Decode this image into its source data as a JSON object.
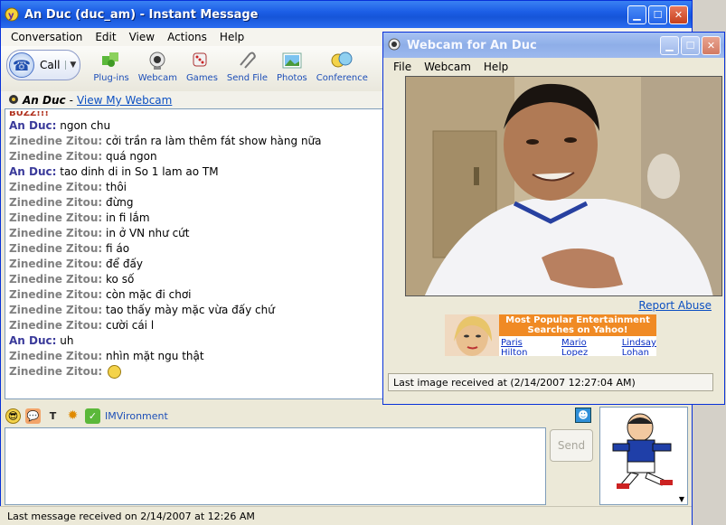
{
  "main_window": {
    "title": "An Duc (duc_am) - Instant Message",
    "menu": [
      "Conversation",
      "Edit",
      "View",
      "Actions",
      "Help"
    ],
    "toolbar": {
      "call": "Call",
      "tools": [
        "Plug-ins",
        "Webcam",
        "Games",
        "Send File",
        "Photos",
        "Conference"
      ]
    },
    "userbar": {
      "name": "An Duc",
      "separator": "-",
      "link": "View My Webcam"
    },
    "chat": {
      "buzz": "BUZZ!!!",
      "messages": [
        {
          "sender": "An Duc:",
          "text": "ngon chu"
        },
        {
          "sender": "Zinedine Zitou:",
          "text": "cởi trần ra làm thêm fát show hàng nữa"
        },
        {
          "sender": "Zinedine Zitou:",
          "text": "quá ngon"
        },
        {
          "sender": "An Duc:",
          "text": "tao dinh di in So 1 lam ao TM"
        },
        {
          "sender": "Zinedine Zitou:",
          "text": "thôi"
        },
        {
          "sender": "Zinedine Zitou:",
          "text": "đừng"
        },
        {
          "sender": "Zinedine Zitou:",
          "text": "in fi lắm"
        },
        {
          "sender": "Zinedine Zitou:",
          "text": "in ở VN như cứt"
        },
        {
          "sender": "Zinedine Zitou:",
          "text": "fi áo"
        },
        {
          "sender": "Zinedine Zitou:",
          "text": "để đấy"
        },
        {
          "sender": "Zinedine Zitou:",
          "text": "ko số"
        },
        {
          "sender": "Zinedine Zitou:",
          "text": "còn mặc đi chơi"
        },
        {
          "sender": "Zinedine Zitou:",
          "text": "tao thấy mày mặc vừa đấy chứ"
        },
        {
          "sender": "Zinedine Zitou:",
          "text": "cười cái l"
        },
        {
          "sender": "An Duc:",
          "text": "uh"
        },
        {
          "sender": "Zinedine Zitou:",
          "text": "nhìn mặt ngu thật"
        },
        {
          "sender": "Zinedine Zitou:",
          "text": ""
        }
      ]
    },
    "emobar": {
      "imvironment": "IMVironment"
    },
    "send": "Send",
    "status": "Last message received on 2/14/2007 at 12:26 AM"
  },
  "webcam_window": {
    "title": "Webcam for An Duc",
    "menu": [
      "File",
      "Webcam",
      "Help"
    ],
    "report": "Report Abuse",
    "ad": {
      "title": "Most Popular Entertainment Searches on Yahoo!",
      "links": [
        [
          "Paris",
          "Hilton"
        ],
        [
          "Mario",
          "Lopez"
        ],
        [
          "Lindsay",
          "Lohan"
        ]
      ]
    },
    "status": "Last image received at (2/14/2007 12:27:04 AM)"
  },
  "colors": {
    "title_blue": "#1c5ee6",
    "link_blue": "#0b4fc2",
    "ad_orange": "#f08a24"
  }
}
